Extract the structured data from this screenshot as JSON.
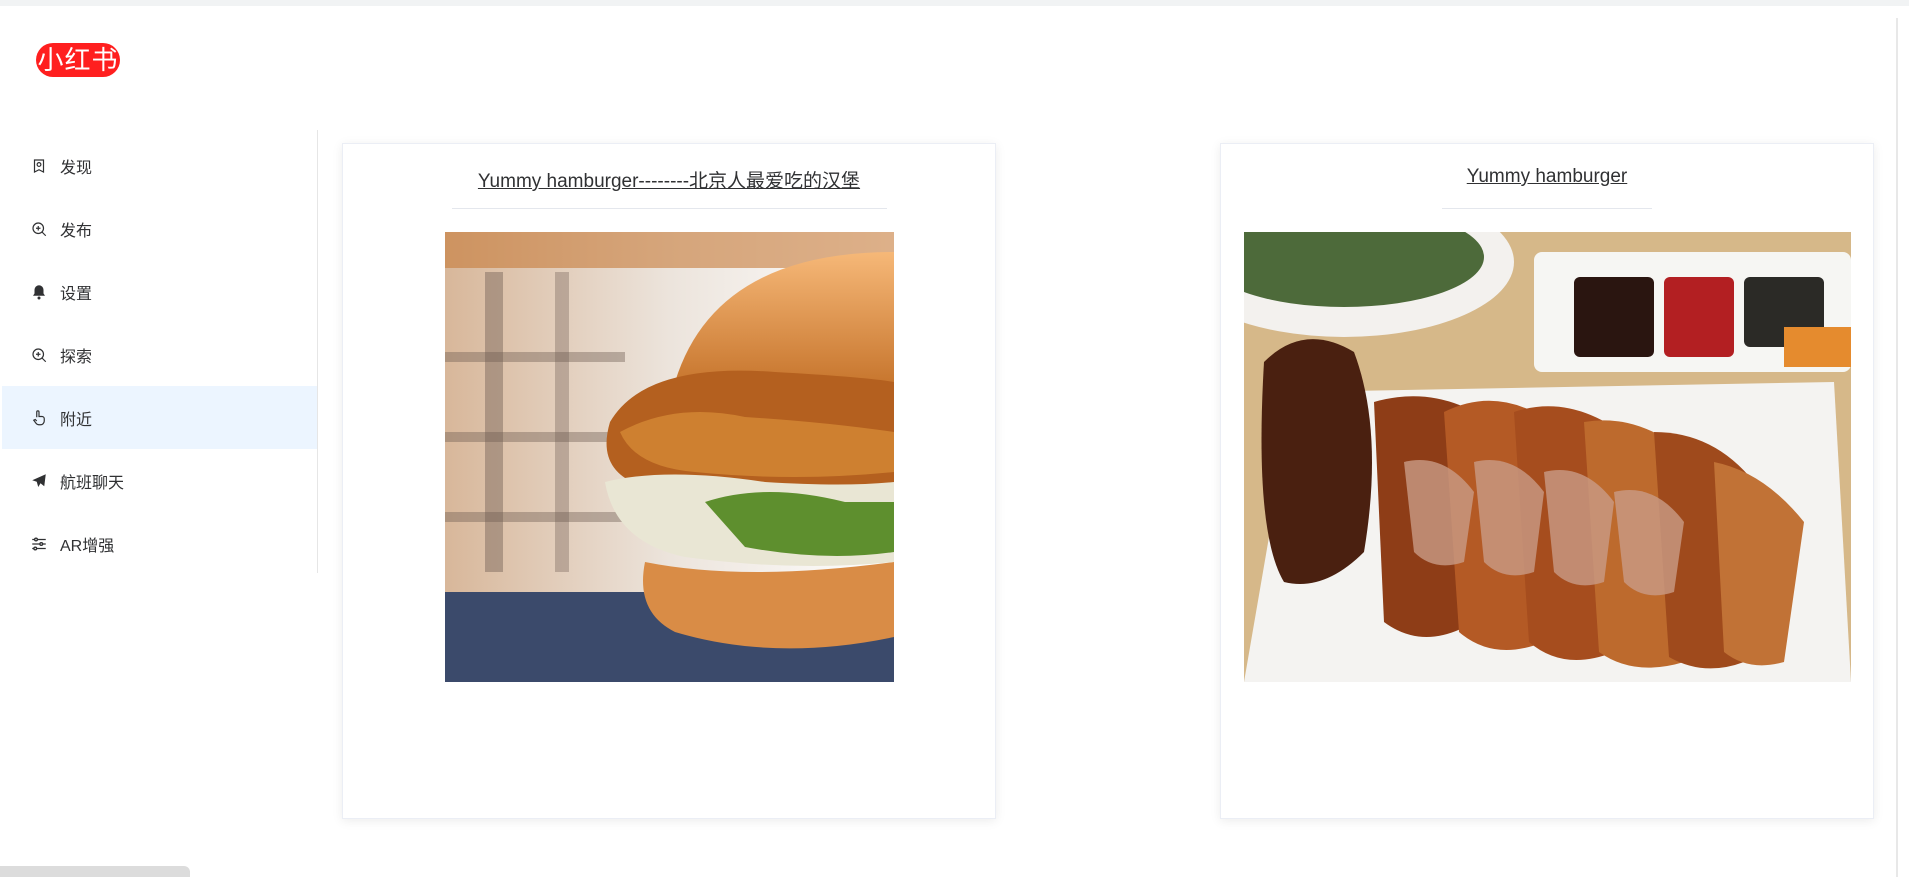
{
  "app": {
    "logo_text": "小红书",
    "brand_color": "#ff1f1f",
    "active_bg_color": "#ecf5ff"
  },
  "sidebar": {
    "items": [
      {
        "label": "发现",
        "icon": "compass-icon",
        "active": false
      },
      {
        "label": "发布",
        "icon": "zoom-in-icon",
        "active": false
      },
      {
        "label": "设置",
        "icon": "bell-icon",
        "active": false
      },
      {
        "label": "探索",
        "icon": "zoom-in-icon",
        "active": false
      },
      {
        "label": "附近",
        "icon": "pointer-icon",
        "active": true
      },
      {
        "label": "航班聊天",
        "icon": "paper-plane-icon",
        "active": false
      },
      {
        "label": "AR增强",
        "icon": "sliders-icon",
        "active": false
      }
    ]
  },
  "cards": [
    {
      "title": "Yummy hamburger--------北京人最爱吃的汉堡",
      "image": "hamburger-photo"
    },
    {
      "title": "Yummy hamburger",
      "image": "roast-duck-photo"
    }
  ]
}
